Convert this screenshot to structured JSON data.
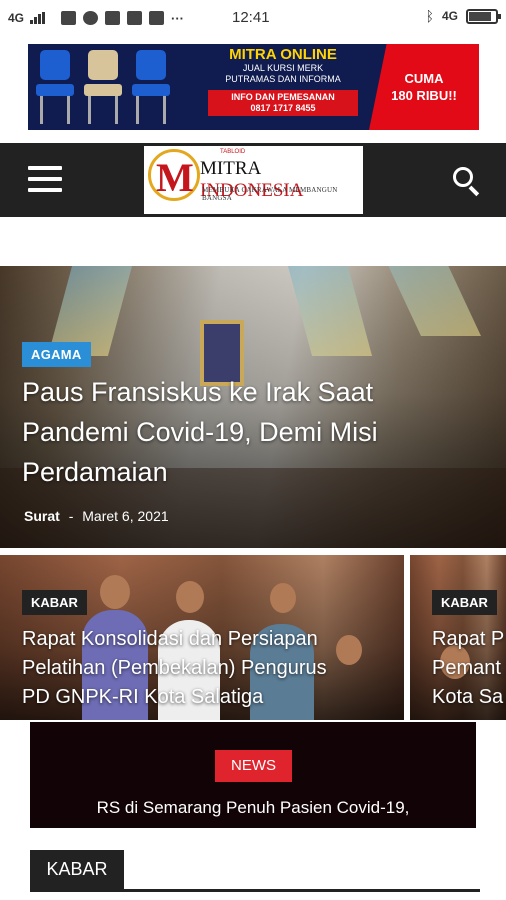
{
  "status_bar": {
    "network": "4G",
    "time": "12:41",
    "network_right": "4G",
    "notification_icons": [
      "message-icon",
      "chat-bubble-icon",
      "instagram-icon",
      "qr-icon",
      "mail-icon"
    ],
    "more": "···"
  },
  "ad": {
    "title": "MITRA ONLINE",
    "line1": "JUAL KURSI MERK",
    "line2": "PUTRAMAS DAN INFORMA",
    "info_line1": "INFO DAN PEMESANAN",
    "info_line2": "0817 1717 8455",
    "price_line1": "CUMA",
    "price_line2": "180 RIBU!!"
  },
  "header": {
    "logo_small": "TABLOID",
    "logo_name_part1": "MITRA ",
    "logo_name_part2": "INDONESIA",
    "logo_tagline": "MEMBUKA CAKRAWALA MEMBANGUN BANGSA",
    "colors": {
      "bar": "#222222",
      "logo_red": "#c4161c",
      "logo_gold": "#e3a81d"
    }
  },
  "hero": {
    "category": "AGAMA",
    "title": "Paus Fransiskus ke Irak Saat Pandemi Covid-19, Demi Misi Perdamaian",
    "author": "Surat",
    "separator": "-",
    "date": "Maret 6, 2021",
    "badge_color": "#2a8fd6"
  },
  "cards": [
    {
      "category": "KABAR",
      "title_line1": "Rapat Konsolidasi dan Persiapan",
      "title_line2": "Pelatihan (Pembekalan) Pengurus",
      "title_line3": "PD GNPK-RI Kota Salatiga"
    },
    {
      "category": "KABAR",
      "title_line1": "Rapat P",
      "title_line2": "Pemant",
      "title_line3": "Kota Sa"
    }
  ],
  "ticker": {
    "badge": "NEWS",
    "text": "RS di Semarang Penuh Pasien Covid-19,"
  },
  "section": {
    "label": "KABAR"
  }
}
